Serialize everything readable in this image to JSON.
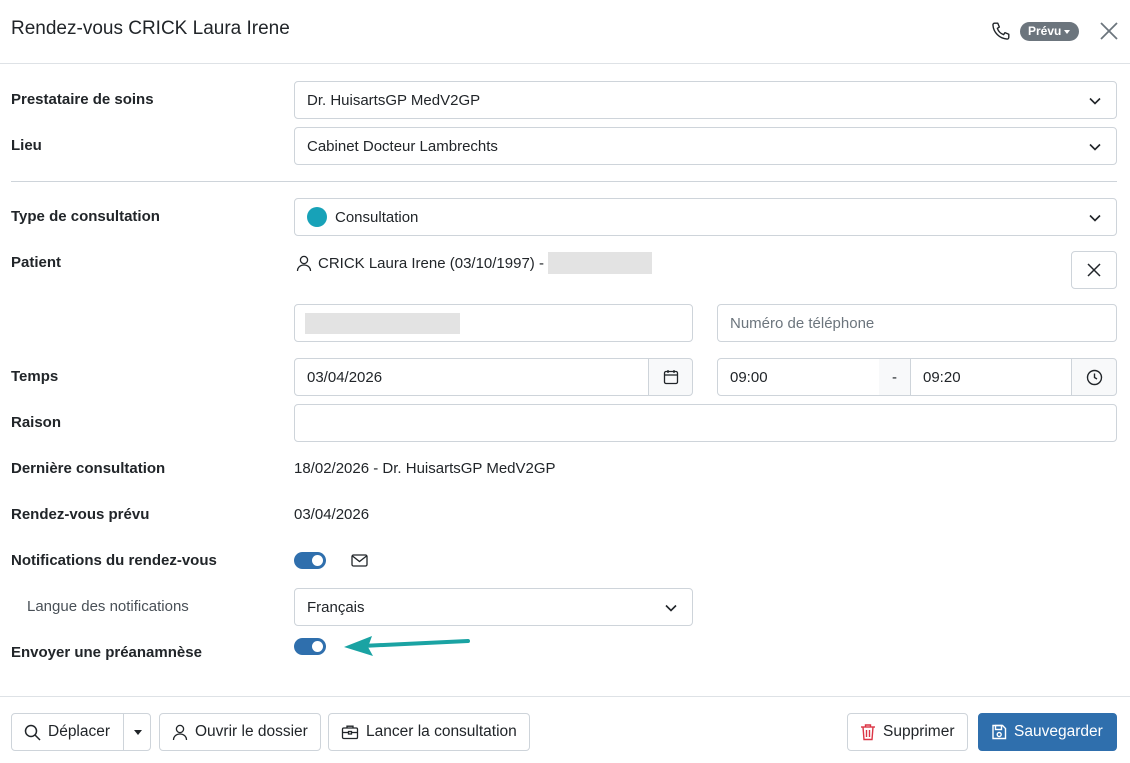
{
  "header": {
    "title": "Rendez-vous CRICK Laura Irene",
    "status_badge": "Prévu",
    "icons": [
      "phone-icon",
      "close-icon"
    ]
  },
  "form": {
    "provider": {
      "label": "Prestataire de soins",
      "value": "Dr. HuisartsGP MedV2GP"
    },
    "location": {
      "label": "Lieu",
      "value": "Cabinet Docteur Lambrechts"
    },
    "consult_type": {
      "label": "Type de consultation",
      "value": "Consultation",
      "color": "#17a2b8"
    },
    "patient": {
      "label": "Patient",
      "name": "CRICK Laura Irene (03/10/1997) -"
    },
    "phone": {
      "placeholder": "Numéro de téléphone"
    },
    "time": {
      "label": "Temps",
      "date": "03/04/2026",
      "start": "09:00",
      "separator": "-",
      "end": "09:20"
    },
    "reason": {
      "label": "Raison",
      "value": ""
    },
    "last_consult": {
      "label": "Dernière consultation",
      "value": "18/02/2026 - Dr. HuisartsGP MedV2GP"
    },
    "planned": {
      "label": "Rendez-vous prévu",
      "value": "03/04/2026"
    },
    "notifications": {
      "label": "Notifications du rendez-vous",
      "enabled": true
    },
    "notif_language": {
      "label": "Langue des notifications",
      "value": "Français"
    },
    "preanamnesis": {
      "label": "Envoyer une préanamnèse",
      "enabled": true
    }
  },
  "footer": {
    "move": "Déplacer",
    "open_file": "Ouvrir le dossier",
    "start_consult": "Lancer la consultation",
    "delete": "Supprimer",
    "save": "Sauvegarder"
  },
  "colors": {
    "primary": "#2f6fad",
    "badge": "#6c757d",
    "annotation_arrow": "#1aa3a3",
    "delete_icon": "#dc3545"
  }
}
